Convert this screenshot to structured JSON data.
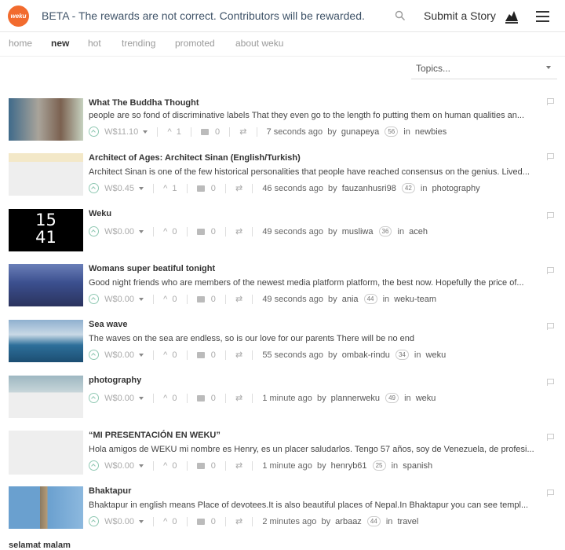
{
  "header": {
    "logo_text": "weku",
    "beta_text": "BETA - The rewards are not correct. Contributors will be rewarded.",
    "submit_label": "Submit a Story"
  },
  "nav": {
    "items": [
      {
        "label": "home",
        "active": false
      },
      {
        "label": "new",
        "active": true
      },
      {
        "label": "hot",
        "active": false
      },
      {
        "label": "trending",
        "active": false
      },
      {
        "label": "promoted",
        "active": false
      },
      {
        "label": "about weku",
        "active": false
      }
    ]
  },
  "topics": {
    "label": "Topics..."
  },
  "posts": [
    {
      "title": "What The Buddha Thought",
      "excerpt": "people are so fond of discriminative labels That they even go to the length fo putting them on human qualities an...",
      "payout": "W$11.10",
      "votes": "1",
      "comments": "0",
      "time": "7 seconds ago",
      "by": "by",
      "author": "gunapeya",
      "rep": "56",
      "in": "in",
      "category": "newbies"
    },
    {
      "title": "Architect of Ages: Architect Sinan (English/Turkish)",
      "excerpt": "Architect Sinan is one of the few historical personalities that people have reached consensus on the genius. Lived...",
      "payout": "W$0.45",
      "votes": "1",
      "comments": "0",
      "time": "46 seconds ago",
      "by": "by",
      "author": "fauzanhusri98",
      "rep": "42",
      "in": "in",
      "category": "photography"
    },
    {
      "title": "Weku",
      "excerpt": "",
      "thumb_text_1": "15",
      "thumb_text_2": "41",
      "payout": "W$0.00",
      "votes": "0",
      "comments": "0",
      "time": "49 seconds ago",
      "by": "by",
      "author": "musliwa",
      "rep": "36",
      "in": "in",
      "category": "aceh"
    },
    {
      "title": "Womans super beatiful tonight",
      "excerpt": "Good night friends who are members of the newest media platform platform, the best now. Hopefully the price of...",
      "payout": "W$0.00",
      "votes": "0",
      "comments": "0",
      "time": "49 seconds ago",
      "by": "by",
      "author": "ania",
      "rep": "44",
      "in": "in",
      "category": "weku-team"
    },
    {
      "title": "Sea wave",
      "excerpt": "The waves on the sea are endless, so is our love for our parents There will be no end",
      "payout": "W$0.00",
      "votes": "0",
      "comments": "0",
      "time": "55 seconds ago",
      "by": "by",
      "author": "ombak-rindu",
      "rep": "34",
      "in": "in",
      "category": "weku"
    },
    {
      "title": "photography",
      "excerpt": "",
      "payout": "W$0.00",
      "votes": "0",
      "comments": "0",
      "time": "1 minute ago",
      "by": "by",
      "author": "plannerweku",
      "rep": "49",
      "in": "in",
      "category": "weku"
    },
    {
      "title": "“MI PRESENTACIÓN EN WEKU”",
      "excerpt": "Hola amigos de WEKU mi nombre es Henry, es un placer saludarlos. Tengo 57 años, soy de Venezuela, de profesi...",
      "payout": "W$0.00",
      "votes": "0",
      "comments": "0",
      "time": "1 minute ago",
      "by": "by",
      "author": "henryb61",
      "rep": "25",
      "in": "in",
      "category": "spanish"
    },
    {
      "title": "Bhaktapur",
      "excerpt": "Bhaktapur in english means Place of devotees.It is also beautiful places of Nepal.In Bhaktapur you can see templ...",
      "payout": "W$0.00",
      "votes": "0",
      "comments": "0",
      "time": "2 minutes ago",
      "by": "by",
      "author": "arbaaz",
      "rep": "44",
      "in": "in",
      "category": "travel"
    }
  ],
  "partial_post": {
    "title": "selamat malam"
  }
}
